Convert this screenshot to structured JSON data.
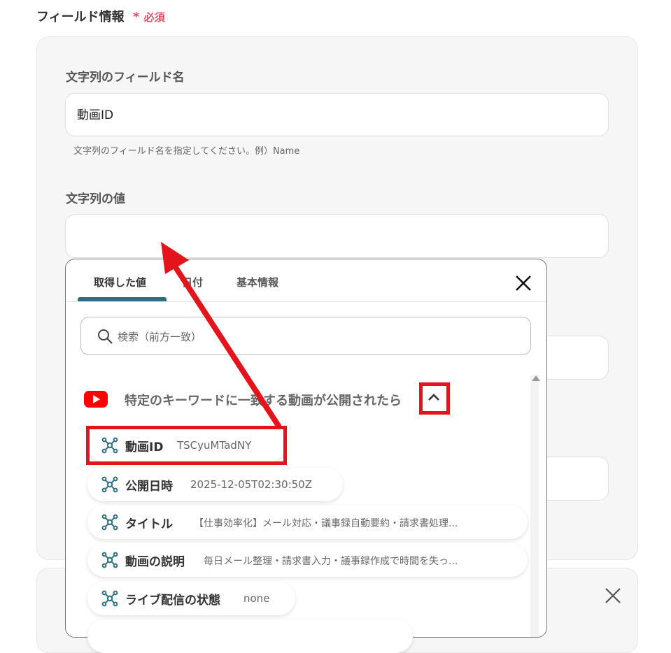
{
  "field_section": {
    "title": "フィールド情報",
    "required_star": "*",
    "required_label": "必須"
  },
  "field_name": {
    "label": "文字列のフィールド名",
    "value": "動画ID",
    "hint": "文字列のフィールド名を指定してください。例）Name"
  },
  "field_value": {
    "label": "文字列の値",
    "value": ""
  },
  "popup": {
    "tabs": [
      {
        "label": "取得した値",
        "active": true
      },
      {
        "label": "日付",
        "active": false
      },
      {
        "label": "基本情報",
        "active": false
      }
    ],
    "search_placeholder": "検索（前方一致）",
    "source": {
      "title": "特定のキーワードに一致する動画が公開されたら",
      "icon": "youtube-icon"
    },
    "items": [
      {
        "name": "動画ID",
        "value": "TSCyuMTadNY"
      },
      {
        "name": "公開日時",
        "value": "2025-12-05T02:30:50Z"
      },
      {
        "name": "タイトル",
        "value": "【仕事効率化】メール対応・議事録自動要約・請求書処理..."
      },
      {
        "name": "動画の説明",
        "value": "毎日メール整理・請求書入力・議事録作成で時間を失っ..."
      },
      {
        "name": "ライブ配信の状態",
        "value": "none"
      }
    ]
  },
  "colors": {
    "accent": "#2f6f85",
    "required": "#e5506a",
    "annotation": "#e3141c",
    "youtube": "#ff0000"
  }
}
